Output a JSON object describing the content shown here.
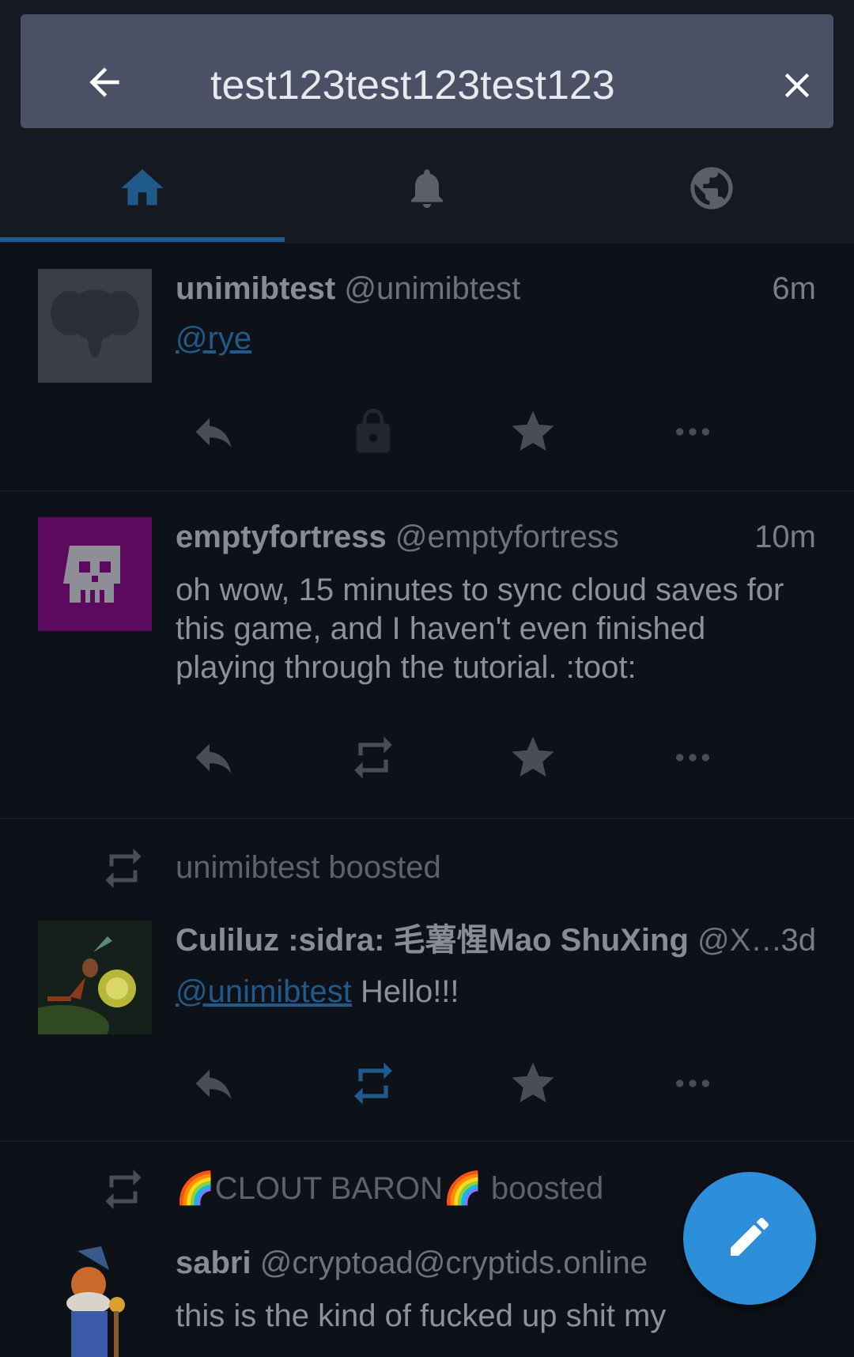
{
  "search": {
    "query": "test123test123test123"
  },
  "tabs": [
    {
      "label": "home-icon",
      "active": true
    },
    {
      "label": "bell-icon",
      "active": false
    },
    {
      "label": "globe-icon",
      "active": false
    }
  ],
  "colors": {
    "accent": "#2d8fd9",
    "indicator": "#1f5a8a",
    "background": "#0e1117",
    "search_bg": "#4c5065",
    "boost_active": "#1f5a8a"
  },
  "statuses": [
    {
      "display_name": "unimibtest",
      "handle": "@unimibtest",
      "time": "6m",
      "content_mention": "@rye",
      "content_text": "",
      "boost_icon": "lock-icon"
    },
    {
      "display_name": "emptyfortress",
      "handle": "@emptyfortress",
      "time": "10m",
      "content_text": "oh wow, 15 minutes to sync cloud saves for this game, and I haven't even finished playing through the tutorial. :toot:",
      "boost_icon": "boost-icon"
    },
    {
      "boosted_by": "unimibtest boosted",
      "display_name": "Culiluz :sidra: 毛薯惺Mao ShuXing",
      "handle": "@X…",
      "time": "3d",
      "content_mention": "@unimibtest",
      "content_text": " Hello!!!",
      "boost_icon": "boost-icon-active"
    },
    {
      "boosted_by": "🌈CLOUT BARON🌈 boosted",
      "display_name": "sabri",
      "handle": "@cryptoad@cryptids.online",
      "time": "",
      "content_text": "this is the kind of fucked up shit my"
    }
  ]
}
